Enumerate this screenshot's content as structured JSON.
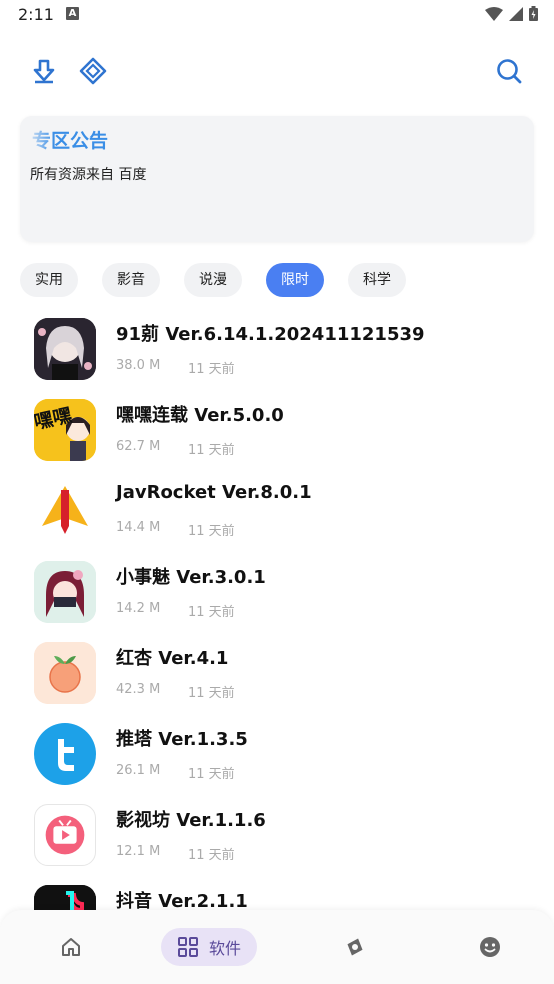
{
  "status_bar": {
    "time": "2:11",
    "indicator": "A"
  },
  "toolbar": {
    "left_icons": [
      "download-icon",
      "diamond-icon"
    ],
    "right_icons": [
      "search-icon"
    ]
  },
  "notice": {
    "title": "专区公告",
    "text": "所有资源来自 百度"
  },
  "tabs": [
    {
      "label": "实用",
      "active": false
    },
    {
      "label": "影音",
      "active": false
    },
    {
      "label": "说漫",
      "active": false
    },
    {
      "label": "限时",
      "active": true
    },
    {
      "label": "科学",
      "active": false
    }
  ],
  "apps": [
    {
      "name": "91莂 Ver.6.14.1.202411121539",
      "size": "38.0 M",
      "time": "11 天前"
    },
    {
      "name": "嘿嘿连载 Ver.5.0.0",
      "size": "62.7 M",
      "time": "11 天前"
    },
    {
      "name": "JavRocket Ver.8.0.1",
      "size": "14.4 M",
      "time": "11 天前"
    },
    {
      "name": "小事魅 Ver.3.0.1",
      "size": "14.2 M",
      "time": "11 天前"
    },
    {
      "name": "红杏 Ver.4.1",
      "size": "42.3 M",
      "time": "11 天前"
    },
    {
      "name": "推塔 Ver.1.3.5",
      "size": "26.1 M",
      "time": "11 天前"
    },
    {
      "name": "影视坊 Ver.1.1.6",
      "size": "12.1 M",
      "time": "11 天前"
    },
    {
      "name": "抖音 Ver.2.1.1",
      "size": "",
      "time": ""
    }
  ],
  "icon_text": {
    "heihei": "嘿嘿"
  },
  "bottom_nav": {
    "items": [
      {
        "icon": "home-icon",
        "active": false
      },
      {
        "icon": "grid-icon",
        "label": "软件",
        "active": true
      },
      {
        "icon": "compass-icon",
        "active": false
      },
      {
        "icon": "smiley-icon",
        "active": false
      }
    ]
  },
  "colors": {
    "accent": "#4a7ff2",
    "notice_title": "#3a8ee6",
    "nav_active_bg": "#e8e2f6"
  }
}
